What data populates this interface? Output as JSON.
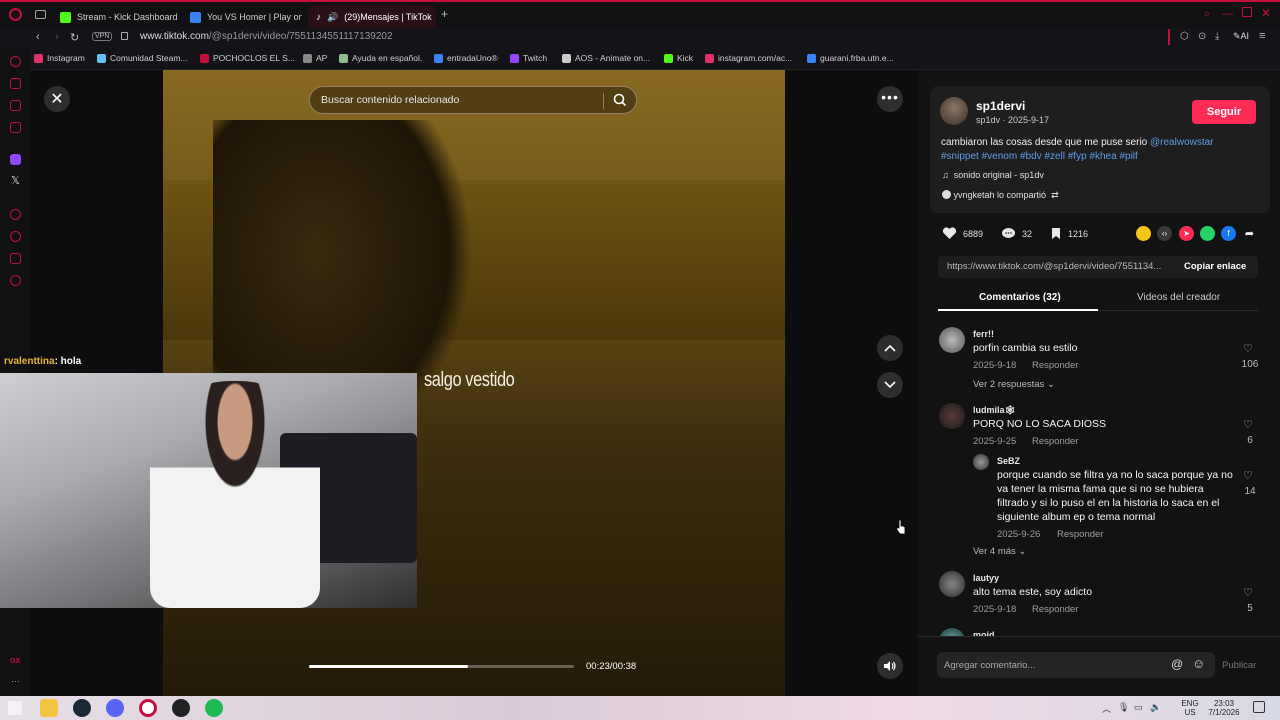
{
  "browser": {
    "tabs": [
      {
        "label": "Stream - Kick Dashboard",
        "color": "#53fc18"
      },
      {
        "label": "You VS Homer | Play on R",
        "color": "#3b82f6"
      },
      {
        "label": "(29)Mensajes | TikTok",
        "color": "#ffffff",
        "active": true
      }
    ],
    "new_tab": "+",
    "url_host": "www.tiktok.com",
    "url_path": "/@sp1dervi/video/7551134551117139202",
    "vpn": "VPN",
    "ai": "AI",
    "bookmarks": [
      {
        "label": "Instagram",
        "color": "#e1306c"
      },
      {
        "label": "Comunidad Steam...",
        "color": "#66c0f4"
      },
      {
        "label": "POCHOCLOS EL S...",
        "color": "#c4103d"
      },
      {
        "label": "AP",
        "color": "#888888"
      },
      {
        "label": "Ayuda en español.",
        "color": "#8fbf8f"
      },
      {
        "label": "entradaUno®",
        "color": "#3b82f6"
      },
      {
        "label": "Twitch",
        "color": "#9146ff"
      },
      {
        "label": "AOS - Animate on...",
        "color": "#cccccc"
      },
      {
        "label": "Kick",
        "color": "#53fc18"
      },
      {
        "label": "instagram.com/ac...",
        "color": "#e1306c"
      },
      {
        "label": "guarani.frba.utn.e...",
        "color": "#3b82f6"
      }
    ],
    "sidebar_badge": "GX"
  },
  "video": {
    "search_placeholder": "Buscar contenido relacionado",
    "caption": "salgo vestido",
    "chat_user": "rvalenttina",
    "chat_message": ": hola",
    "timecode": "00:23/00:38",
    "progress_fraction": 0.6
  },
  "post": {
    "username": "sp1dervi",
    "handle_date": "sp1dv · 2025-9-17",
    "follow_label": "Seguir",
    "description": "cambiaron las cosas desde que me puse serio ",
    "mention": "@realwowstar",
    "hashtags": "#snippet #venom #bdv #zell #fyp #khea #pilf",
    "sound": "sonido original - sp1dv",
    "shared_by": "yvngketah lo compartió",
    "likes": "6889",
    "comments": "32",
    "saves": "1216",
    "link": "https://www.tiktok.com/@sp1dervi/video/7551134...",
    "copy_label": "Copiar enlace",
    "tab_comments": "Comentarios (32)",
    "tab_videos": "Videos del creador"
  },
  "comments": [
    {
      "name": "ferr!!",
      "text": "porfin cambia su estilo",
      "date": "2025-9-18",
      "reply": "Responder",
      "likes": "106",
      "more": "Ver 2 respuestas"
    },
    {
      "name": "ludmila🕸",
      "text": "PORQ NO LO SACA DIOSS",
      "date": "2025-9-25",
      "reply": "Responder",
      "likes": "6"
    },
    {
      "name": "SeBZ",
      "text": "porque cuando se filtra ya no lo saca porque ya no va tener la misma fama que si no se hubiera filtrado y si lo puso el en la historia lo saca en el siguiente album ep o tema normal",
      "date": "2025-9-26",
      "reply": "Responder",
      "likes": "14",
      "more": "Ver 4 más"
    },
    {
      "name": "lautyy",
      "text": "alto tema este, soy adicto",
      "date": "2025-9-18",
      "reply": "Responder",
      "likes": "5"
    },
    {
      "name": "moid"
    }
  ],
  "composer": {
    "placeholder": "Agregar comentario...",
    "publish": "Publicar"
  },
  "taskbar": {
    "lang": "ENG",
    "region": "US",
    "time": "23:03",
    "date": "7/1/2026"
  }
}
